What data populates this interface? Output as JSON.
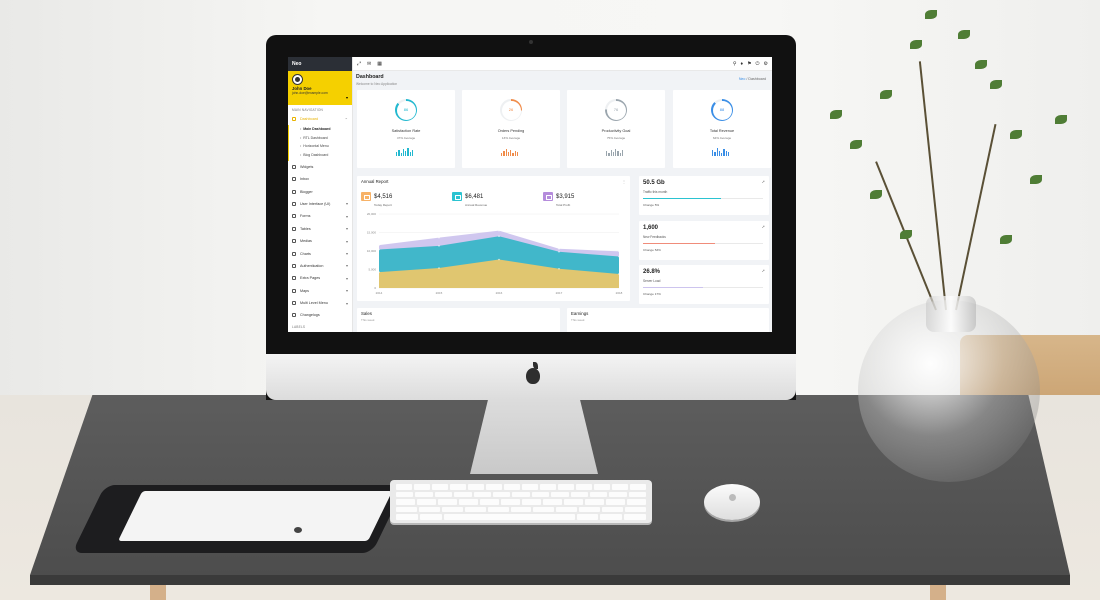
{
  "app": {
    "brand": "Neo"
  },
  "user": {
    "name": "John Doe",
    "email": "john-doe@example.com"
  },
  "sidebar": {
    "section_label": "MAIN NAVIGATION",
    "dashboard_label": "Dashboard",
    "submenu": [
      "Main Dashboard",
      "RTL Dashboard",
      "Horizontal Menu",
      "Blog Dashboard"
    ],
    "items": [
      "Widgets",
      "Inbox",
      "Blogger",
      "User Interface (UI)",
      "Forms",
      "Tables",
      "Medias",
      "Charts",
      "Authentication",
      "Extra Pages",
      "Maps",
      "Multi Level Menu",
      "Changelogs"
    ],
    "footer_label": "LABELS"
  },
  "page": {
    "title": "Dashboard",
    "subtitle": "Welcome to Neo Application"
  },
  "breadcrumb": {
    "home": "Neo",
    "separator": "/",
    "current": "Dashboard"
  },
  "stats": [
    {
      "title": "Satisfaction Rate",
      "sub": "47% Average",
      "value": "86",
      "color": "#22b8cf"
    },
    {
      "title": "Orders Pending",
      "sub": "13% Average",
      "value": "26",
      "color": "#f08c4a"
    },
    {
      "title": "Productivity Goal",
      "sub": "75% Average",
      "value": "76",
      "color": "#9aa5ad"
    },
    {
      "title": "Total Revenue",
      "sub": "64% Average",
      "value": "88",
      "color": "#3a8ee6"
    }
  ],
  "annual": {
    "title": "Annual Report",
    "kpis": [
      {
        "value": "$4,516",
        "label": "Today Report",
        "color": "#f7b267"
      },
      {
        "value": "$6,481",
        "label": "Annual Revenue",
        "color": "#2bc3d1"
      },
      {
        "value": "$3,915",
        "label": "Total Profit",
        "color": "#b58cdc"
      }
    ]
  },
  "chart_data": {
    "type": "area",
    "x": [
      "2014",
      "2015",
      "2016",
      "2017",
      "2018"
    ],
    "yticks": [
      "20,000",
      "15,000",
      "10,000",
      "5,000",
      "0"
    ],
    "ylim": [
      0,
      20000
    ],
    "grid": true,
    "series": [
      {
        "color": "#e9c66a",
        "values": [
          4300,
          5400,
          7700,
          5200,
          3800
        ]
      },
      {
        "color": "#39b6c7",
        "values": [
          10400,
          11400,
          14000,
          9800,
          8500
        ]
      },
      {
        "color": "#cdc4ee",
        "values": [
          11600,
          13600,
          15500,
          10600,
          9900
        ]
      }
    ]
  },
  "side_cards": [
    {
      "value": "50.5 Gb",
      "label": "Traffic this month",
      "change": "Change 5%",
      "fill": 0.65,
      "color": "#2bc3d1"
    },
    {
      "value": "1,600",
      "label": "New Feedbacks",
      "change": "Change 53%",
      "fill": 0.6,
      "color": "#f08c7a"
    },
    {
      "value": "26.8%",
      "label": "Server Load",
      "change": "Change 17%",
      "fill": 0.5,
      "color": "#cdc4ee"
    }
  ],
  "bottom_cards": [
    {
      "title": "Sales",
      "sub": "This week"
    },
    {
      "title": "Earnings",
      "sub": "This week"
    }
  ]
}
